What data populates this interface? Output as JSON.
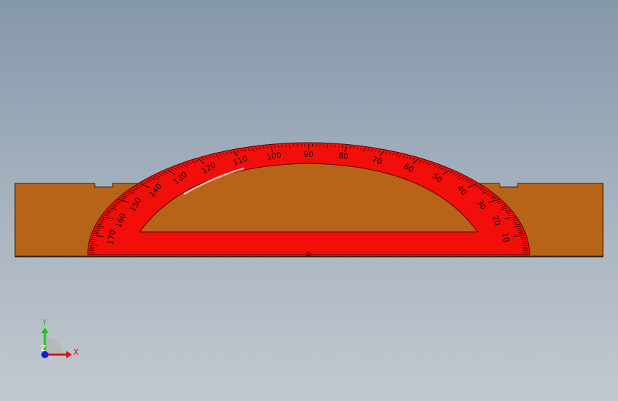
{
  "viewport": {
    "background_top": "#8598ab",
    "background_bottom": "#c2c8cf"
  },
  "model": {
    "base_color": "#b86418",
    "protractor_color": "#f20f0a",
    "marking_color": "#1a0000",
    "scale_labels": [
      "10",
      "20",
      "30",
      "40",
      "50",
      "60",
      "70",
      "80",
      "90",
      "100",
      "110",
      "120",
      "130",
      "140",
      "150",
      "160",
      "170"
    ]
  },
  "triad": {
    "x_label": "X",
    "y_label": "Y",
    "z_label": "Z",
    "x_color": "#e01010",
    "y_color": "#20c020",
    "z_color": "#1020e0"
  }
}
